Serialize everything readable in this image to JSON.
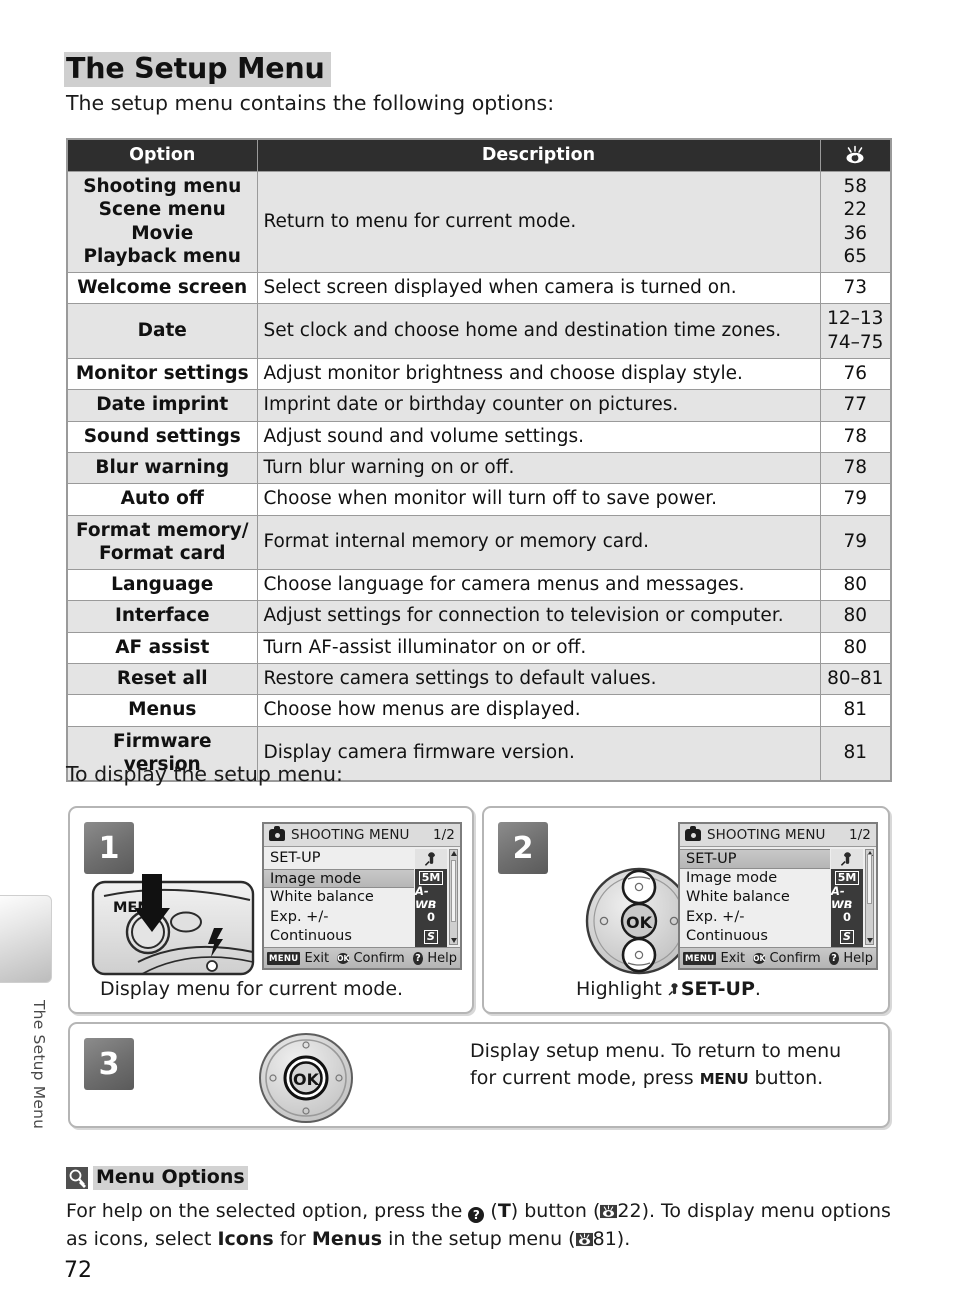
{
  "chapter_tab": {
    "label": "The Setup Menu"
  },
  "page": {
    "title": "The Setup Menu",
    "intro": "The setup menu contains the following options:",
    "to_display": "To display the setup menu:",
    "page_number": "72"
  },
  "table": {
    "headers": {
      "option": "Option",
      "description": "Description",
      "page_icon": "eye-reference-icon"
    },
    "group_row": {
      "options": [
        "Shooting menu",
        "Scene menu",
        "Movie",
        "Playback menu"
      ],
      "description": "Return to menu for current mode.",
      "pages": [
        "58",
        "22",
        "36",
        "65"
      ]
    },
    "rows": [
      {
        "option": "Welcome screen",
        "description": "Select screen displayed when camera is turned on.",
        "pages": [
          "73"
        ]
      },
      {
        "option": "Date",
        "description": "Set clock and choose home and destination time zones.",
        "pages": [
          "12–13",
          "74–75"
        ]
      },
      {
        "option": "Monitor settings",
        "description": "Adjust monitor brightness and choose display style.",
        "pages": [
          "76"
        ]
      },
      {
        "option": "Date imprint",
        "description": "Imprint date or birthday counter on pictures.",
        "pages": [
          "77"
        ]
      },
      {
        "option": "Sound settings",
        "description": "Adjust sound and volume settings.",
        "pages": [
          "78"
        ]
      },
      {
        "option": "Blur warning",
        "description": "Turn blur warning on or off.",
        "pages": [
          "78"
        ]
      },
      {
        "option": "Auto off",
        "description": "Choose when monitor will turn off to save power.",
        "pages": [
          "79"
        ]
      },
      {
        "option": "Format memory/\nFormat card",
        "description": "Format internal memory or memory card.",
        "pages": [
          "79"
        ]
      },
      {
        "option": "Language",
        "description": "Choose language for camera menus and messages.",
        "pages": [
          "80"
        ]
      },
      {
        "option": "Interface",
        "description": "Adjust settings for connection to television or computer.",
        "pages": [
          "80"
        ]
      },
      {
        "option": "AF assist",
        "description": "Turn AF-assist illuminator on or off.",
        "pages": [
          "80"
        ]
      },
      {
        "option": "Reset all",
        "description": "Restore camera settings to default values.",
        "pages": [
          "80–81"
        ]
      },
      {
        "option": "Menus",
        "description": "Choose how menus are displayed.",
        "pages": [
          "81"
        ]
      },
      {
        "option": "Firmware version",
        "description": "Display camera firmware version.",
        "pages": [
          "81"
        ]
      }
    ]
  },
  "steps": [
    {
      "number": "1",
      "caption": "Display menu for current mode.",
      "camera_button_label": "MENU",
      "lcd": {
        "title": "SHOOTING MENU",
        "page": "1/2",
        "items": [
          "SET-UP",
          "Image mode",
          "White balance",
          "Exp. +/-",
          "Continuous"
        ],
        "selected_index": 1,
        "icons": [
          "wrench",
          "5M",
          "A-WB",
          "0",
          "S"
        ],
        "footer": {
          "exit_key": "MENU",
          "exit_label": "Exit",
          "ok_key": "OK",
          "ok_label": "Confirm",
          "help_key": "?",
          "help_label": "Help"
        }
      }
    },
    {
      "number": "2",
      "caption_prefix": "Highlight ",
      "caption_icon": "wrench-icon",
      "caption_bold": "SET-UP",
      "caption_suffix": ".",
      "lcd": {
        "title": "SHOOTING MENU",
        "page": "1/2",
        "items": [
          "SET-UP",
          "Image mode",
          "White balance",
          "Exp. +/-",
          "Continuous"
        ],
        "selected_index": 0,
        "icons": [
          "wrench",
          "5M",
          "A-WB",
          "0",
          "S"
        ],
        "footer": {
          "exit_key": "MENU",
          "exit_label": "Exit",
          "ok_key": "OK",
          "ok_label": "Confirm",
          "help_key": "?",
          "help_label": "Help"
        }
      },
      "selector_highlight": "up-down"
    },
    {
      "number": "3",
      "caption_line1": "Display setup menu.  To return to menu",
      "caption_line2_pre": "for current mode, press ",
      "caption_key": "MENU",
      "caption_line2_post": " button.",
      "selector_highlight": "center-ok",
      "ok_label": "OK"
    }
  ],
  "note": {
    "icon": "magnifier-icon",
    "title": "Menu Options",
    "line1_a": "For help on the selected option, press the ",
    "line1_qmark": "?",
    "line1_b": " (",
    "line1_t": "T",
    "line1_c": ") button (",
    "line1_pg": "22",
    "line1_d": ").  To display menu options",
    "line2_a": "as icons, select ",
    "line2_bold1": "Icons",
    "line2_b": " for ",
    "line2_bold2": "Menus",
    "line2_c": " in the setup menu (",
    "line2_pg": "81",
    "line2_d": ")."
  }
}
